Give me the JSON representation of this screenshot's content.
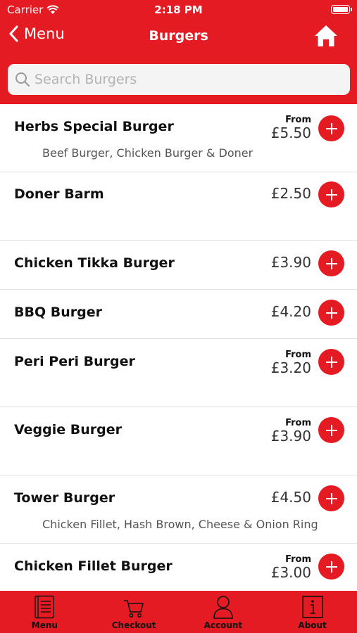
{
  "status_bar": {
    "carrier": "Carrier",
    "time": "2:18 PM"
  },
  "nav": {
    "back_label": "Menu",
    "title": "Burgers"
  },
  "search": {
    "placeholder": "Search Burgers",
    "value": ""
  },
  "items": [
    {
      "name": "Herbs Special Burger",
      "from": "From",
      "price": "£5.50",
      "description": "Beef Burger, Chicken Burger & Doner"
    },
    {
      "name": "Doner Barm",
      "from": "",
      "price": "£2.50",
      "description": ""
    },
    {
      "name": "Chicken Tikka Burger",
      "from": "",
      "price": "£3.90",
      "description": ""
    },
    {
      "name": "BBQ Burger",
      "from": "",
      "price": "£4.20",
      "description": ""
    },
    {
      "name": "Peri Peri Burger",
      "from": "From",
      "price": "£3.20",
      "description": ""
    },
    {
      "name": "Veggie Burger",
      "from": "From",
      "price": "£3.90",
      "description": ""
    },
    {
      "name": "Tower Burger",
      "from": "",
      "price": "£4.50",
      "description": "Chicken Fillet, Hash Brown, Cheese & Onion Ring"
    },
    {
      "name": "Chicken Fillet Burger",
      "from": "From",
      "price": "£3.00",
      "description": ""
    }
  ],
  "tabbar": {
    "menu": "Menu",
    "checkout": "Checkout",
    "account": "Account",
    "about": "About"
  },
  "colors": {
    "brand": "#e41b23",
    "text": "#111111",
    "divider": "#e2e2e2"
  },
  "icons": {
    "wifi": "wifi-icon",
    "battery": "battery-icon",
    "back": "chevron-left-icon",
    "home": "home-icon",
    "search": "search-icon",
    "add": "plus-icon",
    "menu": "menu-book-icon",
    "checkout": "cart-icon",
    "account": "person-icon",
    "about": "info-icon"
  }
}
